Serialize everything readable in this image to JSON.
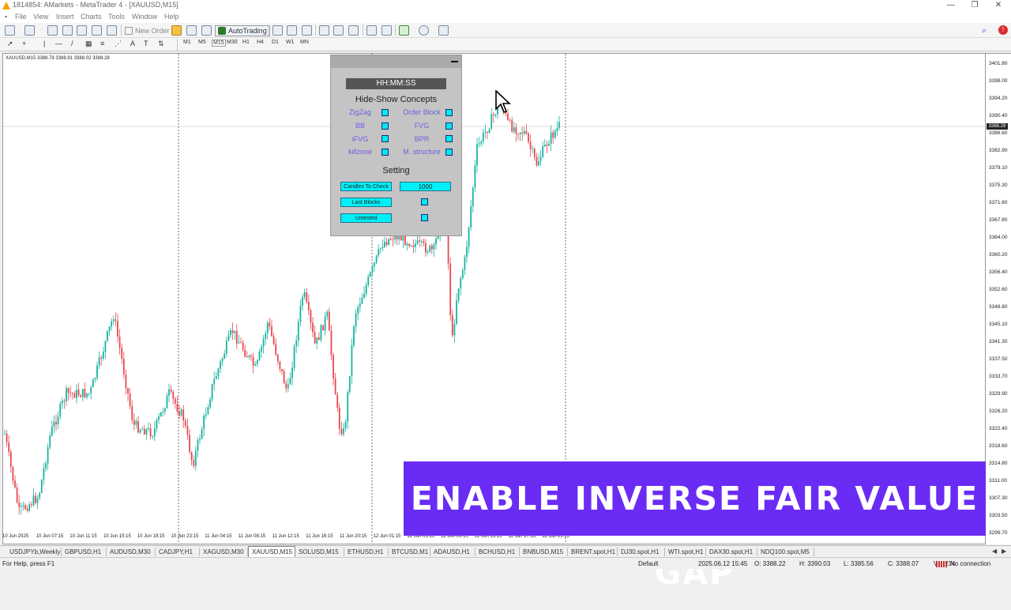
{
  "window": {
    "title": "1814854: AMarkets - MetaTrader 4 - [XAUUSD,M15]",
    "accent": "#f5a000"
  },
  "menu": [
    "File",
    "View",
    "Insert",
    "Charts",
    "Tools",
    "Window",
    "Help"
  ],
  "toolbar": {
    "new_order": "New Order",
    "auto_trading": "AutoTrading"
  },
  "timeframes": [
    "M1",
    "M5",
    "M15",
    "M30",
    "H1",
    "H4",
    "D1",
    "W1",
    "MN"
  ],
  "chart": {
    "symbol_label": "XAUUSD,M15  3388.78 3388.91 3388.02 3388.28",
    "current_price": "3388.28",
    "price_labels": [
      "3401.80",
      "3398.00",
      "3394.20",
      "3390.40",
      "3386.60",
      "3382.90",
      "3379.10",
      "3375.30",
      "3371.60",
      "3367.80",
      "3364.00",
      "3360.20",
      "3356.40",
      "3352.60",
      "3348.80",
      "3345.10",
      "3341.30",
      "3337.50",
      "3333.70",
      "3329.90",
      "3326.20",
      "3322.40",
      "3318.60",
      "3314.80",
      "3311.00",
      "3307.30",
      "3303.50",
      "3299.70"
    ],
    "time_labels": [
      "10 Jun 2025",
      "10 Jun 07:15",
      "10 Jun 11:15",
      "10 Jun 15:15",
      "10 Jun 19:15",
      "10 Jun 23:15",
      "11 Jun 04:15",
      "11 Jun 08:15",
      "11 Jun 12:15",
      "11 Jun 16:15",
      "11 Jun 20:15",
      "12 Jun 01:15",
      "12 Jun 05:15",
      "12 Jun 09:15",
      "12 Jun 13:15",
      "12 Jun 17:15",
      "12 Jun 21:15"
    ],
    "bull_color": "#16b3a0",
    "bear_color": "#e8474c"
  },
  "panel": {
    "clock": "HH:MM:SS",
    "concepts_title": "Hide-Show Concepts",
    "concepts_left": [
      "ZigZag",
      "BB",
      "iFVG",
      "killzone"
    ],
    "concepts_right": [
      "Order Block",
      "FVG",
      "BPR",
      "M. structure"
    ],
    "setting_title": "Setting",
    "candles_to_check_label": "Candles To Check",
    "candles_to_check_value": "1000",
    "last_blocks_label": "Last Blocks",
    "untested_label": "Untested"
  },
  "banner": "ENABLE INVERSE FAIR VALUE GAP",
  "symbol_tabs": [
    "USDJPYb,Weekly",
    "GBPUSD,H1",
    "AUDUSD,M30",
    "CADJPY,H1",
    "XAGUSD,M30",
    "XAUUSD,M15",
    "SOLUSD,M15",
    "ETHUSD,H1",
    "BTCUSD,M1",
    "ADAUSD,H1",
    "BCHUSD,H1",
    "BNBUSD,M15",
    "BRENT.spot,H1",
    "DJ30.spot,H1",
    "WTI.spot,H1",
    "DAX30.spot,H1",
    "NDQ100.spot,M5"
  ],
  "active_tab": "XAUUSD,M15",
  "status": {
    "help": "For Help, press F1",
    "profile": "Default",
    "datetime": "2025.06.12 15:45",
    "open": "O: 3388.22",
    "high": "H: 3390.03",
    "low": "L: 3385.56",
    "close": "C: 3388.07",
    "volume": "V: 2234",
    "connection": "No connection"
  }
}
